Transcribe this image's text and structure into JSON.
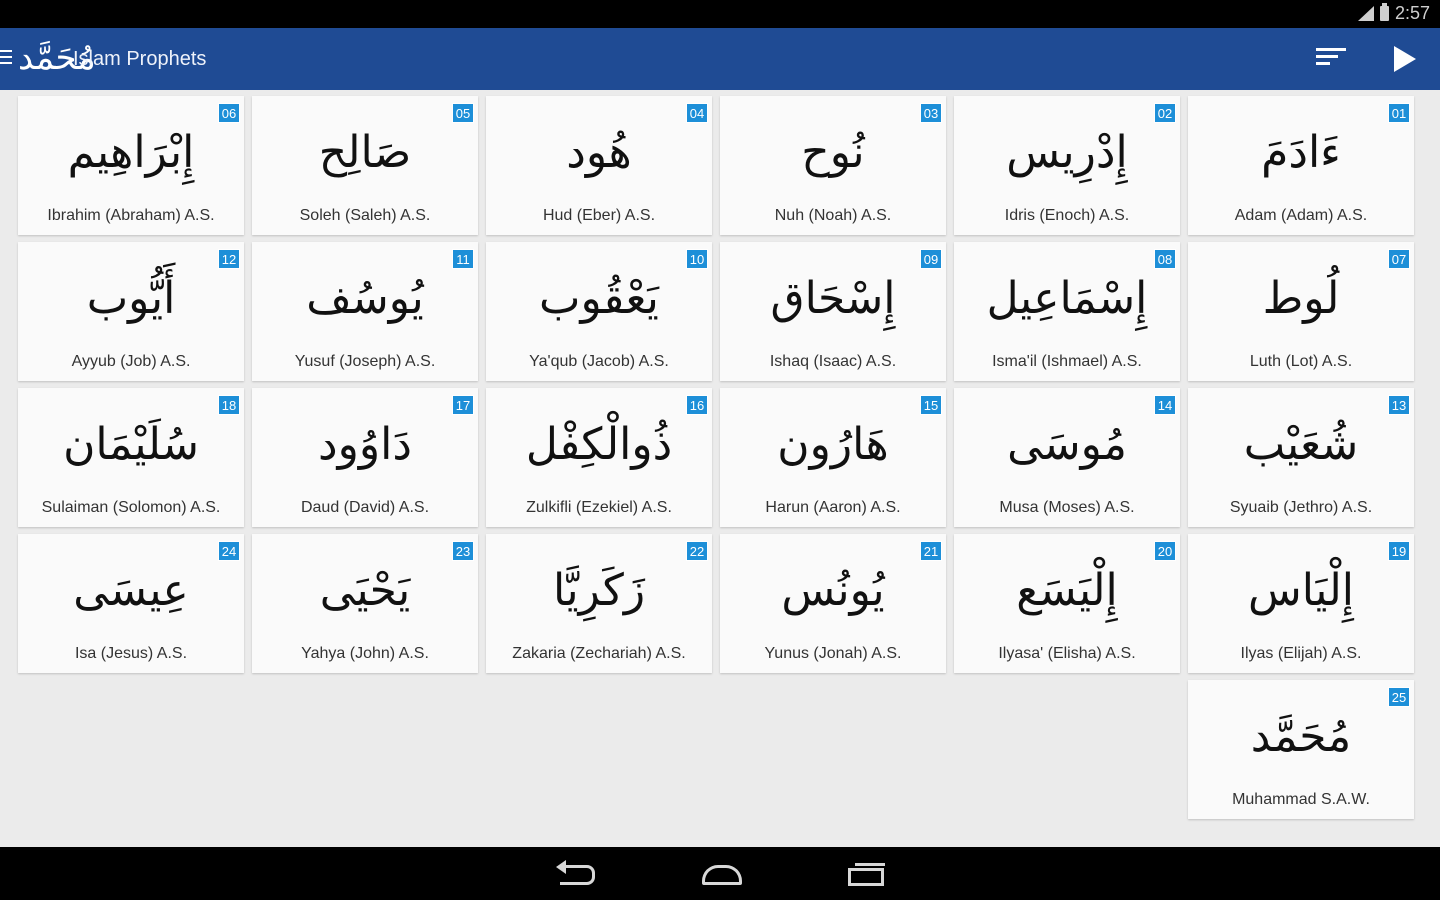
{
  "status": {
    "time": "2:57"
  },
  "appbar": {
    "title": "Islam Prophets",
    "logo_text": "مُحَمَّد"
  },
  "prophets": [
    {
      "num": "01",
      "arabic": "ءَادَمَ",
      "name": "Adam (Adam) A.S."
    },
    {
      "num": "02",
      "arabic": "إِدْرِيس",
      "name": "Idris (Enoch) A.S."
    },
    {
      "num": "03",
      "arabic": "نُوح",
      "name": "Nuh (Noah) A.S."
    },
    {
      "num": "04",
      "arabic": "هُود",
      "name": "Hud (Eber) A.S."
    },
    {
      "num": "05",
      "arabic": "صَالِح",
      "name": "Soleh (Saleh) A.S."
    },
    {
      "num": "06",
      "arabic": "إِبْرَاهِيم",
      "name": "Ibrahim (Abraham) A.S."
    },
    {
      "num": "07",
      "arabic": "لُوط",
      "name": "Luth (Lot) A.S."
    },
    {
      "num": "08",
      "arabic": "إِسْمَاعِيل",
      "name": "Isma'il (Ishmael) A.S."
    },
    {
      "num": "09",
      "arabic": "إِسْحَاق",
      "name": "Ishaq (Isaac) A.S."
    },
    {
      "num": "10",
      "arabic": "يَعْقُوب",
      "name": "Ya'qub (Jacob) A.S."
    },
    {
      "num": "11",
      "arabic": "يُوسُف",
      "name": "Yusuf (Joseph) A.S."
    },
    {
      "num": "12",
      "arabic": "أَيُّوب",
      "name": "Ayyub (Job) A.S."
    },
    {
      "num": "13",
      "arabic": "شُعَيْب",
      "name": "Syuaib (Jethro) A.S."
    },
    {
      "num": "14",
      "arabic": "مُوسَى",
      "name": "Musa (Moses) A.S."
    },
    {
      "num": "15",
      "arabic": "هَارُون",
      "name": "Harun (Aaron) A.S."
    },
    {
      "num": "16",
      "arabic": "ذُوالْكِفْل",
      "name": "Zulkifli (Ezekiel) A.S."
    },
    {
      "num": "17",
      "arabic": "دَاوُود",
      "name": "Daud (David) A.S."
    },
    {
      "num": "18",
      "arabic": "سُلَيْمَان",
      "name": "Sulaiman (Solomon) A.S."
    },
    {
      "num": "19",
      "arabic": "إِلْيَاس",
      "name": "Ilyas (Elijah) A.S."
    },
    {
      "num": "20",
      "arabic": "إِلْيَسَع",
      "name": "Ilyasa' (Elisha) A.S."
    },
    {
      "num": "21",
      "arabic": "يُونُس",
      "name": "Yunus (Jonah) A.S."
    },
    {
      "num": "22",
      "arabic": "زَكَرِيَّا",
      "name": "Zakaria (Zechariah) A.S."
    },
    {
      "num": "23",
      "arabic": "يَحْيَى",
      "name": "Yahya (John) A.S."
    },
    {
      "num": "24",
      "arabic": "عِيسَى",
      "name": "Isa (Jesus) A.S."
    },
    {
      "num": "25",
      "arabic": "مُحَمَّد",
      "name": "Muhammad S.A.W."
    }
  ],
  "colors": {
    "appbar": "#1f4b94",
    "badge": "#1d8fd8",
    "background": "#ebebeb",
    "card": "#fafafa"
  }
}
